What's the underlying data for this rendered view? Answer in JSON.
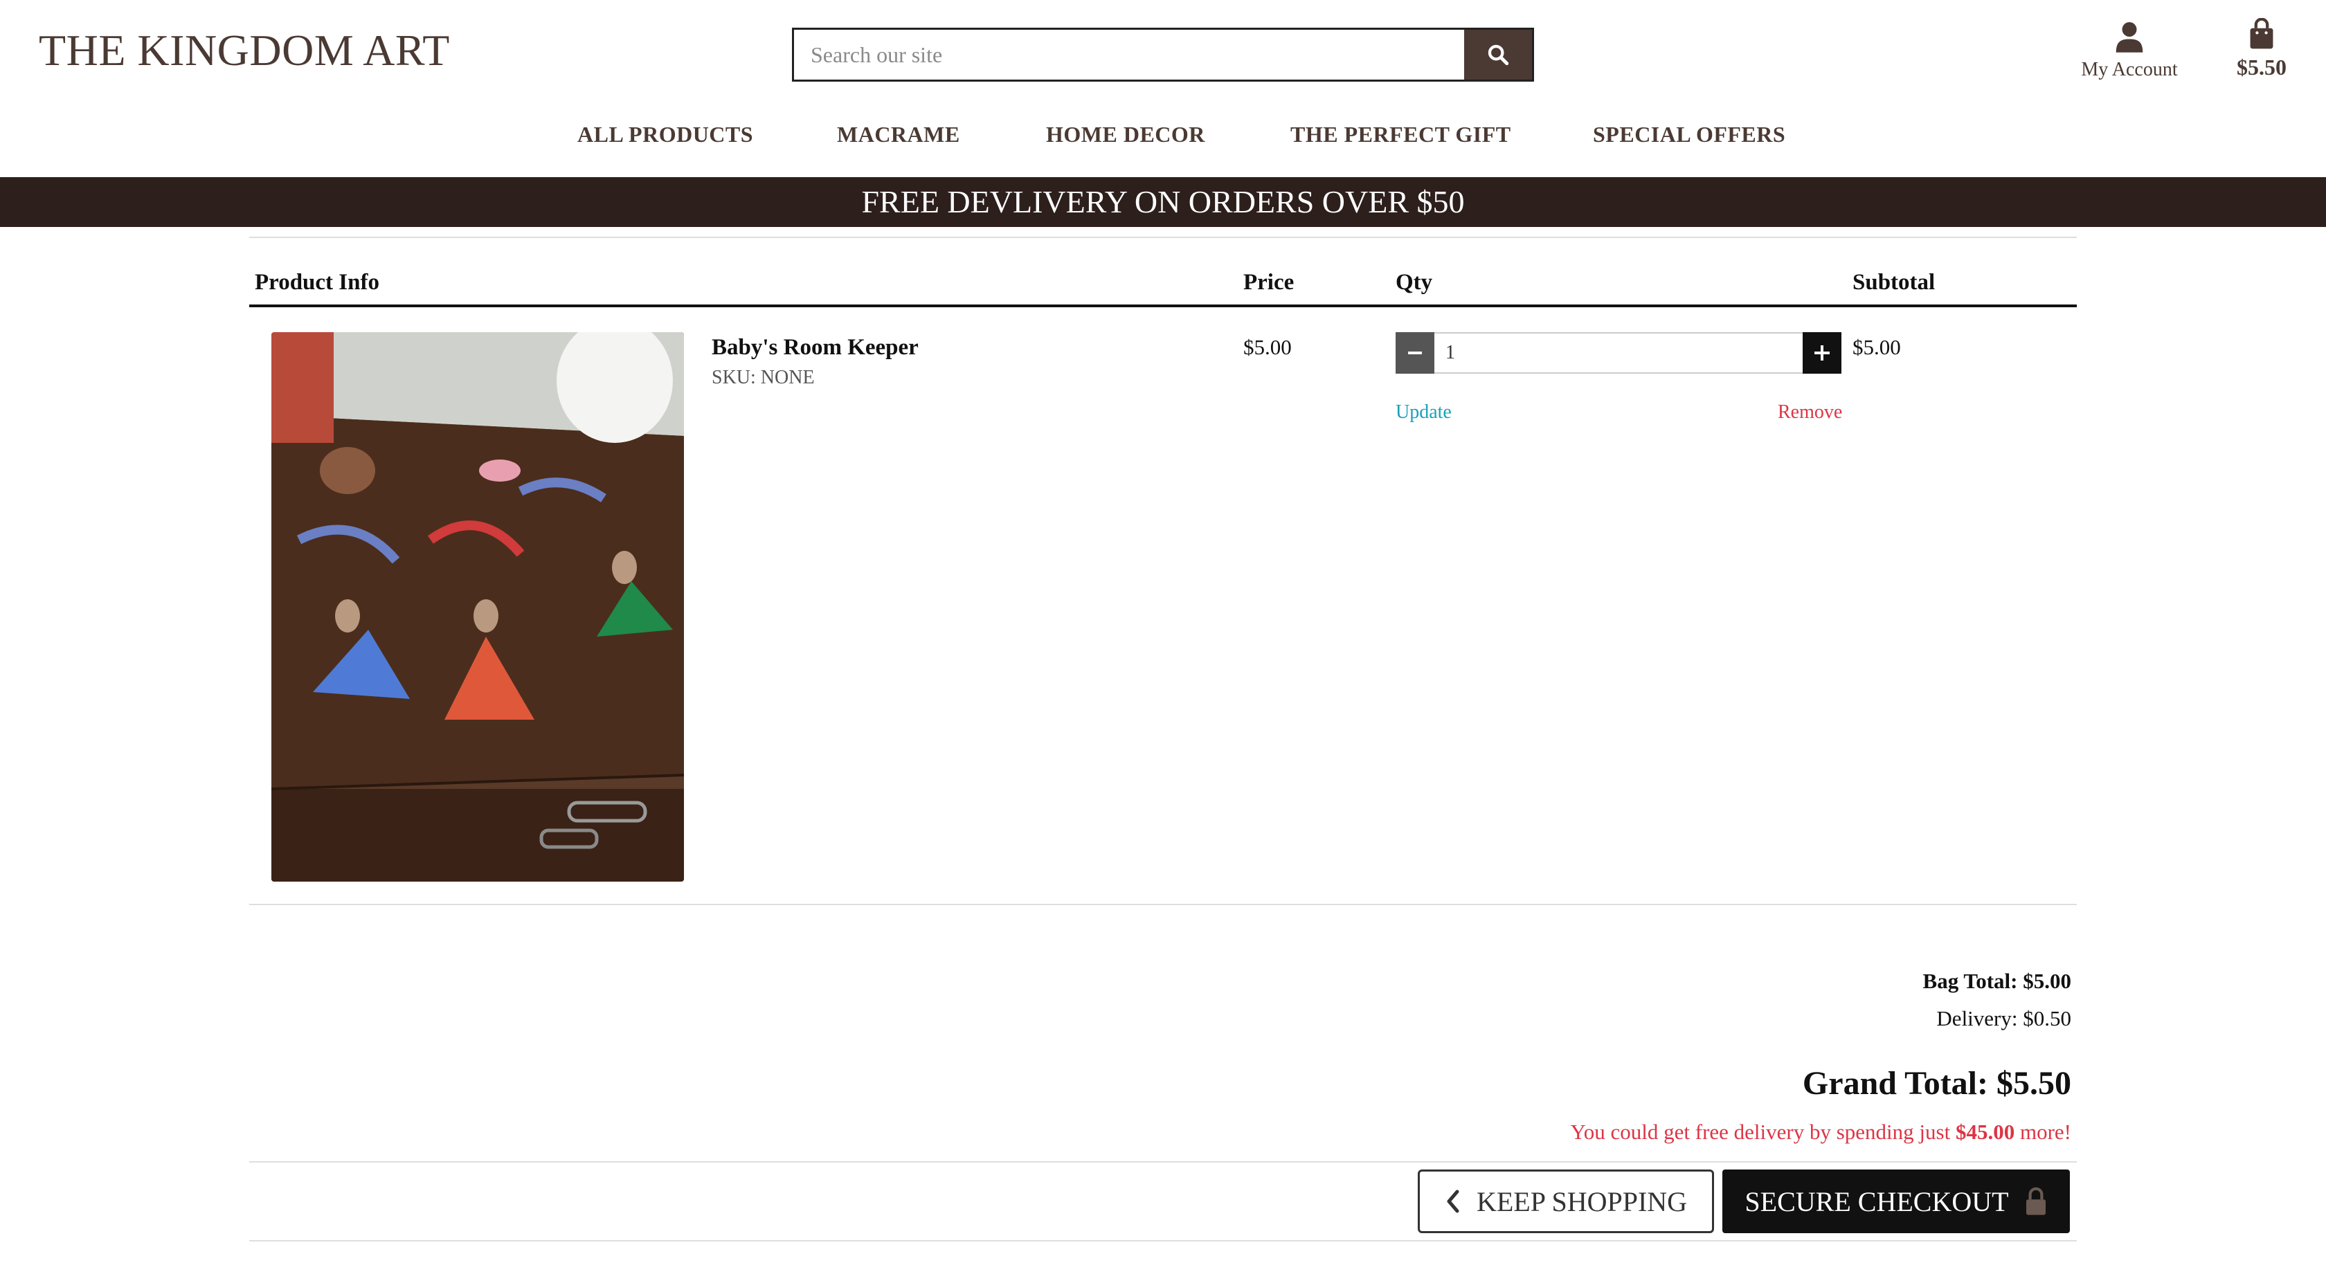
{
  "header": {
    "logo": "THE KINGDOM ART",
    "search_placeholder": "Search our site",
    "account_label": "My Account",
    "bag_amount": "$5.50"
  },
  "nav": {
    "items": [
      {
        "label": "ALL PRODUCTS"
      },
      {
        "label": "MACRAME"
      },
      {
        "label": "HOME DECOR"
      },
      {
        "label": "THE PERFECT GIFT"
      },
      {
        "label": "SPECIAL OFFERS"
      }
    ]
  },
  "banner": "FREE DEVLIVERY ON ORDERS OVER $50",
  "table": {
    "headers": {
      "product_info": "Product Info",
      "price": "Price",
      "qty": "Qty",
      "subtotal": "Subtotal"
    },
    "rows": [
      {
        "name": "Baby's Room Keeper",
        "sku": "SKU: NONE",
        "price": "$5.00",
        "qty": "1",
        "subtotal": "$5.00",
        "update_label": "Update",
        "remove_label": "Remove"
      }
    ]
  },
  "totals": {
    "bag_total": "Bag Total: $5.00",
    "delivery": "Delivery: $0.50",
    "grand_total": "Grand Total: $5.50",
    "free_msg_prefix": "You could get free delivery by spending just ",
    "free_msg_amount": "$45.00",
    "free_msg_suffix": " more!"
  },
  "buttons": {
    "keep_shopping": "KEEP SHOPPING",
    "secure_checkout": "SECURE CHECKOUT"
  },
  "colors": {
    "brand": "#4a3a33",
    "banner_bg": "#2d1f1c",
    "link_update": "#17a2b8",
    "link_remove": "#dc3545"
  }
}
